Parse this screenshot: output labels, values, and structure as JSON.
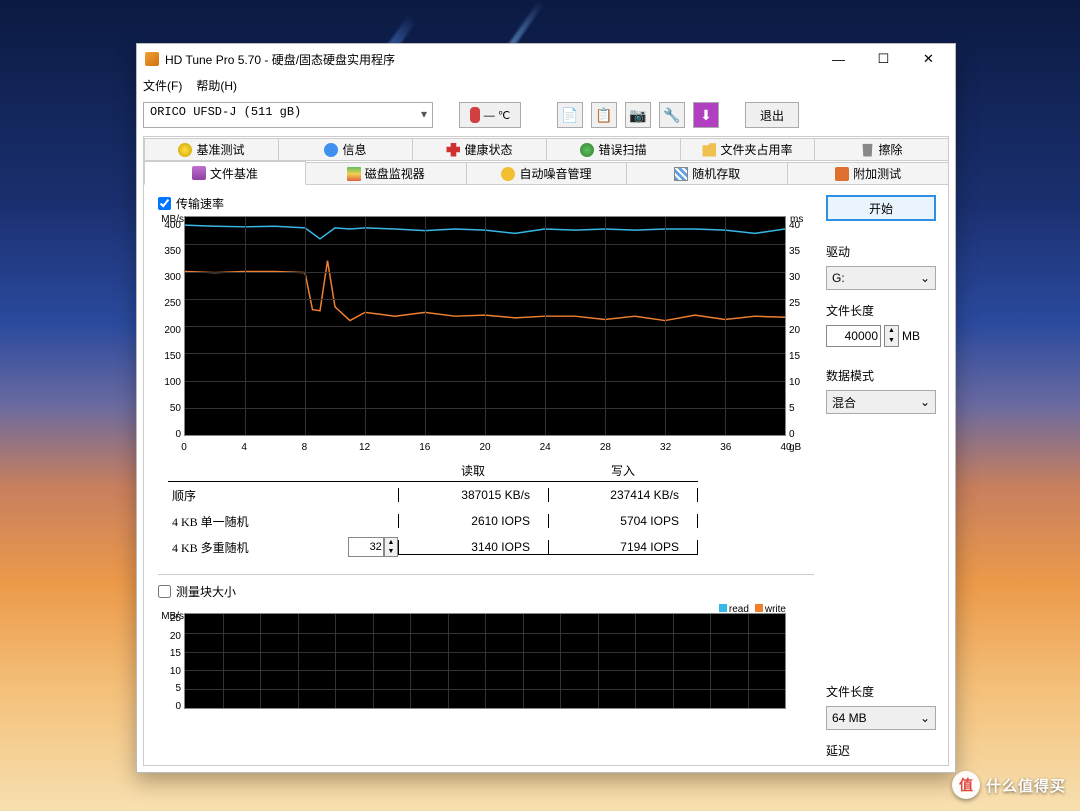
{
  "window": {
    "title": "HD Tune Pro 5.70 - 硬盘/固态硬盘实用程序"
  },
  "menubar": {
    "file": "文件(F)",
    "help": "帮助(H)"
  },
  "toolbar": {
    "drive": "ORICO   UFSD-J (511 gB)",
    "temperature": "— ℃",
    "exit": "退出"
  },
  "tabs_row1": [
    {
      "icon": "ico-bulb",
      "label": "基准测试"
    },
    {
      "icon": "ico-info",
      "label": "信息"
    },
    {
      "icon": "ico-health",
      "label": "健康状态"
    },
    {
      "icon": "ico-scan",
      "label": "错误扫描"
    },
    {
      "icon": "ico-folder",
      "label": "文件夹占用率"
    },
    {
      "icon": "ico-trash",
      "label": "擦除"
    }
  ],
  "tabs_row2": [
    {
      "icon": "ico-file",
      "label": "文件基准",
      "active": true
    },
    {
      "icon": "ico-monitor",
      "label": "磁盘监视器"
    },
    {
      "icon": "ico-sound",
      "label": "自动噪音管理"
    },
    {
      "icon": "ico-random",
      "label": "随机存取"
    },
    {
      "icon": "ico-extra",
      "label": "附加测试"
    }
  ],
  "checkbox_transfer": "传输速率",
  "checkbox_block": "测量块大小",
  "side": {
    "start": "开始",
    "drive_label": "驱动",
    "drive_value": "G:",
    "file_len_label": "文件长度",
    "file_len_value": "40000",
    "file_len_unit": "MB",
    "data_mode_label": "数据模式",
    "data_mode_value": "混合",
    "file_len2_label": "文件长度",
    "file_len2_value": "64 MB",
    "delay_label": "延迟"
  },
  "results": {
    "hdr_read": "读取",
    "hdr_write": "写入",
    "rows": [
      {
        "label": "顺序",
        "spin": "",
        "read": "387015 KB/s",
        "write": "237414 KB/s"
      },
      {
        "label": "4 KB 单一随机",
        "spin": "",
        "read": "2610 IOPS",
        "write": "5704 IOPS"
      },
      {
        "label": "4 KB 多重随机",
        "spin": "32",
        "read": "3140 IOPS",
        "write": "7194 IOPS"
      }
    ]
  },
  "legend": {
    "read": "read",
    "write": "write"
  },
  "watermark": {
    "badge": "值",
    "text": "什么值得买"
  },
  "chart_data": [
    {
      "type": "line",
      "title": "传输速率",
      "xlabel": "gB",
      "ylabel_left": "MB/s",
      "ylabel_right": "ms",
      "xlim": [
        0,
        40
      ],
      "ylim_left": [
        0,
        400
      ],
      "ylim_right": [
        0,
        40
      ],
      "x_ticks": [
        0,
        4,
        8,
        12,
        16,
        20,
        24,
        28,
        32,
        36,
        40
      ],
      "y_ticks_left": [
        0,
        50,
        100,
        150,
        200,
        250,
        300,
        350,
        400
      ],
      "y_ticks_right": [
        0,
        5,
        10,
        15,
        20,
        25,
        30,
        35,
        40
      ],
      "series": [
        {
          "name": "read (MB/s)",
          "color": "#38b8e8",
          "axis": "left",
          "x": [
            0,
            2,
            4,
            6,
            8,
            9,
            10,
            11,
            12,
            14,
            16,
            18,
            20,
            22,
            24,
            26,
            28,
            30,
            32,
            34,
            36,
            38,
            40
          ],
          "y": [
            385,
            383,
            382,
            383,
            380,
            360,
            380,
            378,
            380,
            378,
            375,
            378,
            376,
            370,
            378,
            376,
            378,
            376,
            378,
            378,
            376,
            370,
            378
          ]
        },
        {
          "name": "write (MB/s)",
          "color": "#f08030",
          "axis": "left",
          "x": [
            0,
            2,
            4,
            6,
            8,
            8.5,
            9,
            9.5,
            10,
            11,
            12,
            14,
            16,
            18,
            20,
            22,
            24,
            26,
            28,
            30,
            32,
            34,
            36,
            38,
            40
          ],
          "y": [
            300,
            298,
            300,
            300,
            298,
            230,
            228,
            320,
            235,
            210,
            225,
            218,
            225,
            218,
            220,
            215,
            218,
            218,
            212,
            218,
            210,
            220,
            212,
            218,
            216
          ]
        }
      ]
    },
    {
      "type": "line",
      "title": "测量块大小",
      "xlabel": "",
      "ylabel_left": "MB/s",
      "ylim_left": [
        0,
        25
      ],
      "y_ticks_left": [
        0,
        5,
        10,
        15,
        20,
        25
      ],
      "series": [
        {
          "name": "read",
          "color": "#38b8e8",
          "x": [],
          "y": []
        },
        {
          "name": "write",
          "color": "#f08030",
          "x": [],
          "y": []
        }
      ]
    }
  ]
}
